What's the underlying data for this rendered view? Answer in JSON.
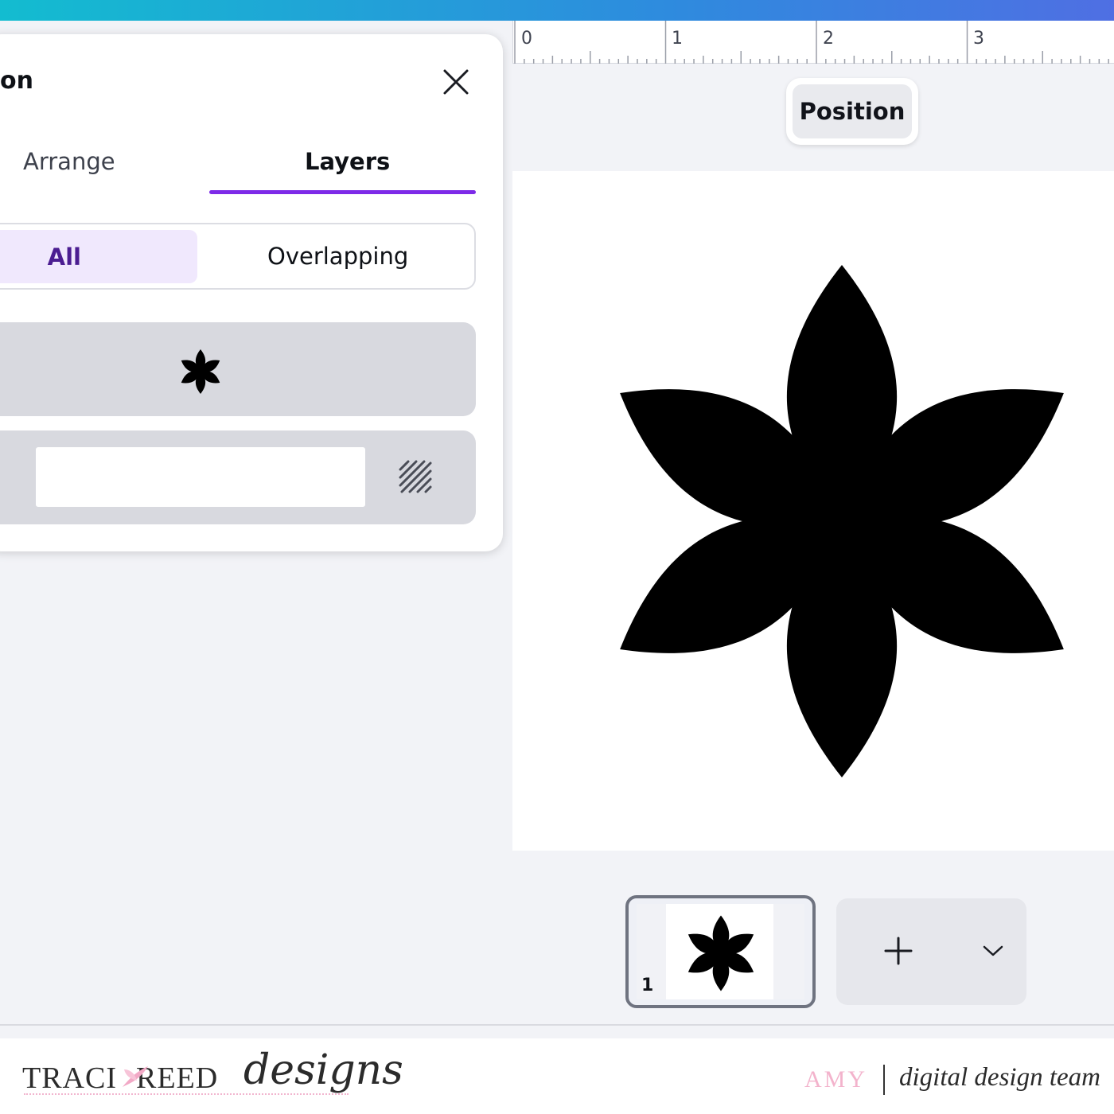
{
  "panel": {
    "title_fragment": "on",
    "tabs": [
      {
        "label": "Arrange",
        "active": false
      },
      {
        "label": "Layers",
        "active": true
      }
    ],
    "filter": {
      "all": "All",
      "overlapping": "Overlapping",
      "selected": "All"
    },
    "layers": [
      {
        "type": "graphic",
        "icon": "flower-icon"
      },
      {
        "type": "background",
        "icon": "lock-hatch-icon"
      }
    ],
    "close_icon": "close-icon"
  },
  "ruler": {
    "marks": [
      "0",
      "1",
      "2",
      "3"
    ]
  },
  "toolbar": {
    "position_label": "Position"
  },
  "pages": {
    "current": "1",
    "add_icon": "plus-icon",
    "expand_icon": "chevron-down-icon"
  },
  "footer": {
    "brand_left": "TRACI",
    "brand_right": "REED",
    "brand_script": "designs",
    "name": "AMY",
    "team": "digital design team"
  },
  "colors": {
    "accent": "#7d2ae8",
    "selected_bg": "#f0e8fd",
    "selected_text": "#4b1d91",
    "topbar_start": "#13bcd0",
    "topbar_end": "#4f6fe3"
  }
}
